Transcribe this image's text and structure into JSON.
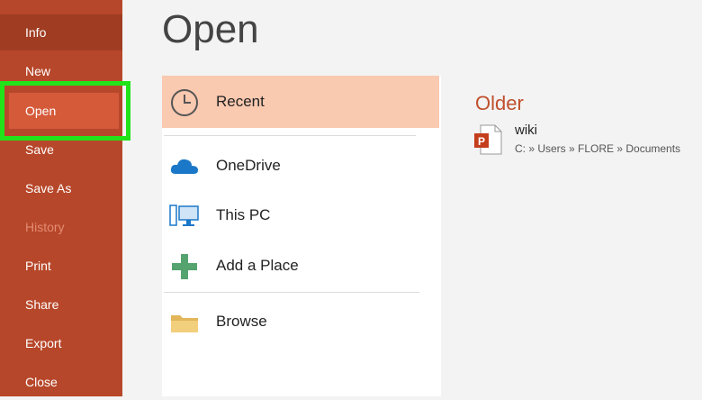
{
  "sidebar": {
    "items": [
      {
        "label": "Info"
      },
      {
        "label": "New"
      },
      {
        "label": "Open"
      },
      {
        "label": "Save"
      },
      {
        "label": "Save As"
      },
      {
        "label": "History"
      },
      {
        "label": "Print"
      },
      {
        "label": "Share"
      },
      {
        "label": "Export"
      },
      {
        "label": "Close"
      }
    ]
  },
  "main": {
    "title": "Open",
    "locations": [
      {
        "label": "Recent",
        "icon": "clock-icon"
      },
      {
        "label": "OneDrive",
        "icon": "cloud-icon"
      },
      {
        "label": "This PC",
        "icon": "computer-icon"
      },
      {
        "label": "Add a Place",
        "icon": "plus-icon"
      },
      {
        "label": "Browse",
        "icon": "folder-icon"
      }
    ]
  },
  "recent": {
    "section_title": "Older",
    "files": [
      {
        "name": "wiki",
        "path": "C: » Users » FLORE » Documents",
        "icon": "powerpoint-file-icon"
      }
    ]
  },
  "colors": {
    "sidebar": "#b7472a",
    "active_item": "#d55a3a",
    "selected_location": "#f9c9b0",
    "accent_text": "#c0502d",
    "highlight": "#22e21a"
  }
}
